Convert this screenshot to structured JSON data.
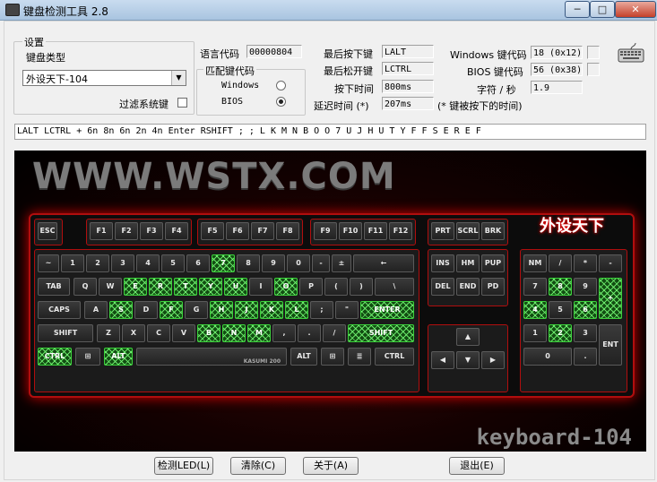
{
  "window": {
    "title": "键盘检测工具 2.8",
    "min_label": "─",
    "max_label": "□",
    "close_label": "✕"
  },
  "settings": {
    "group_label": "设置",
    "kbtype_label": "键盘类型",
    "kbtype_value": "外设天下-104",
    "filter_label": "过滤系统键",
    "lang_code_label": "语言代码",
    "lang_code_value": "00000804",
    "match_group_label": "匹配键代码",
    "windows_label": "Windows",
    "bios_label": "BIOS"
  },
  "status": {
    "last_press_label": "最后按下键",
    "last_press_value": "LALT",
    "last_release_label": "最后松开键",
    "last_release_value": "LCTRL",
    "press_time_label": "按下时间",
    "press_time_value": "800ms",
    "delay_label": "延迟时间 (*)",
    "delay_value": "207ms",
    "delay_note": "(* 键被按下的时间)",
    "win_code_label": "Windows 键代码",
    "win_code_value": "18 (0x12)",
    "bios_code_label": "BIOS 键代码",
    "bios_code_value": "56 (0x38)",
    "cps_label": "字符 / 秒",
    "cps_value": "1.9"
  },
  "log_text": "LALT LCTRL + 6n 8n 6n 2n 4n Enter RSHIFT ; ; L K M N B O O 7 U J H U T Y F F S E R E F",
  "keyboard": {
    "site_text": "WWW.WSTX.COM",
    "model_text": "keyboard-104",
    "brand_text": "外设天下",
    "spacebar_text": "KASUMI 200",
    "keys": [
      {
        "id": "esc",
        "label": "ESC",
        "on": false
      },
      {
        "id": "f1",
        "label": "F1",
        "on": false
      },
      {
        "id": "f2",
        "label": "F2",
        "on": false
      },
      {
        "id": "f3",
        "label": "F3",
        "on": false
      },
      {
        "id": "f4",
        "label": "F4",
        "on": false
      },
      {
        "id": "f5",
        "label": "F5",
        "on": false
      },
      {
        "id": "f6",
        "label": "F6",
        "on": false
      },
      {
        "id": "f7",
        "label": "F7",
        "on": false
      },
      {
        "id": "f8",
        "label": "F8",
        "on": false
      },
      {
        "id": "f9",
        "label": "F9",
        "on": false
      },
      {
        "id": "f10",
        "label": "F10",
        "on": false
      },
      {
        "id": "f11",
        "label": "F11",
        "on": false
      },
      {
        "id": "f12",
        "label": "F12",
        "on": false
      },
      {
        "id": "prt",
        "label": "PRT",
        "on": false
      },
      {
        "id": "scrl",
        "label": "SCRL",
        "on": false
      },
      {
        "id": "brk",
        "label": "BRK",
        "on": false
      },
      {
        "id": "tilde",
        "label": "~",
        "on": false
      },
      {
        "id": "k1",
        "label": "1",
        "on": false
      },
      {
        "id": "k2",
        "label": "2",
        "on": false
      },
      {
        "id": "k3",
        "label": "3",
        "on": false
      },
      {
        "id": "k4",
        "label": "4",
        "on": false
      },
      {
        "id": "k5",
        "label": "5",
        "on": false
      },
      {
        "id": "k6",
        "label": "6",
        "on": false
      },
      {
        "id": "k7",
        "label": "7",
        "on": true
      },
      {
        "id": "k8",
        "label": "8",
        "on": false
      },
      {
        "id": "k9",
        "label": "9",
        "on": false
      },
      {
        "id": "k0",
        "label": "0",
        "on": false
      },
      {
        "id": "minus",
        "label": "-",
        "on": false
      },
      {
        "id": "equal",
        "label": "±",
        "on": false
      },
      {
        "id": "bksp",
        "label": "←",
        "on": false
      },
      {
        "id": "ins",
        "label": "INS",
        "on": false
      },
      {
        "id": "home",
        "label": "HM",
        "on": false
      },
      {
        "id": "pgup",
        "label": "PUP",
        "on": false
      },
      {
        "id": "num",
        "label": "NM",
        "on": false
      },
      {
        "id": "ndiv",
        "label": "/",
        "on": false
      },
      {
        "id": "nmul",
        "label": "*",
        "on": false
      },
      {
        "id": "nsub",
        "label": "-",
        "on": false
      },
      {
        "id": "tab",
        "label": "TAB",
        "on": false
      },
      {
        "id": "q",
        "label": "Q",
        "on": false
      },
      {
        "id": "w",
        "label": "W",
        "on": false
      },
      {
        "id": "e",
        "label": "E",
        "on": true
      },
      {
        "id": "r",
        "label": "R",
        "on": true
      },
      {
        "id": "t",
        "label": "T",
        "on": true
      },
      {
        "id": "y",
        "label": "Y",
        "on": true
      },
      {
        "id": "u",
        "label": "U",
        "on": true
      },
      {
        "id": "i",
        "label": "I",
        "on": false
      },
      {
        "id": "o",
        "label": "O",
        "on": true
      },
      {
        "id": "p",
        "label": "P",
        "on": false
      },
      {
        "id": "lbr",
        "label": "(",
        "on": false
      },
      {
        "id": "rbr",
        "label": ")",
        "on": false
      },
      {
        "id": "bsl",
        "label": "\\",
        "on": false
      },
      {
        "id": "del",
        "label": "DEL",
        "on": false
      },
      {
        "id": "end",
        "label": "END",
        "on": false
      },
      {
        "id": "pgdn",
        "label": "PD",
        "on": false
      },
      {
        "id": "n7",
        "label": "7",
        "on": false
      },
      {
        "id": "n8",
        "label": "8",
        "on": true
      },
      {
        "id": "n9",
        "label": "9",
        "on": false
      },
      {
        "id": "nadd",
        "label": "+",
        "on": true
      },
      {
        "id": "caps",
        "label": "CAPS",
        "on": false
      },
      {
        "id": "a",
        "label": "A",
        "on": false
      },
      {
        "id": "s",
        "label": "S",
        "on": true
      },
      {
        "id": "d",
        "label": "D",
        "on": false
      },
      {
        "id": "f",
        "label": "F",
        "on": true
      },
      {
        "id": "g",
        "label": "G",
        "on": false
      },
      {
        "id": "h",
        "label": "H",
        "on": true
      },
      {
        "id": "j",
        "label": "J",
        "on": true
      },
      {
        "id": "k",
        "label": "K",
        "on": true
      },
      {
        "id": "l",
        "label": "L",
        "on": true
      },
      {
        "id": "semi",
        "label": ";",
        "on": false
      },
      {
        "id": "quote",
        "label": "\"",
        "on": false
      },
      {
        "id": "enter",
        "label": "ENTER",
        "on": true
      },
      {
        "id": "n4",
        "label": "4",
        "on": true
      },
      {
        "id": "n5",
        "label": "5",
        "on": false
      },
      {
        "id": "n6",
        "label": "6",
        "on": true
      },
      {
        "id": "lshift",
        "label": "SHIFT",
        "on": false
      },
      {
        "id": "z",
        "label": "Z",
        "on": false
      },
      {
        "id": "x",
        "label": "X",
        "on": false
      },
      {
        "id": "c",
        "label": "C",
        "on": false
      },
      {
        "id": "v",
        "label": "V",
        "on": false
      },
      {
        "id": "b",
        "label": "B",
        "on": true
      },
      {
        "id": "n",
        "label": "N",
        "on": true
      },
      {
        "id": "m",
        "label": "M",
        "on": true
      },
      {
        "id": "comma",
        "label": ",",
        "on": false
      },
      {
        "id": "period",
        "label": ".",
        "on": false
      },
      {
        "id": "slash",
        "label": "/",
        "on": false
      },
      {
        "id": "rshift",
        "label": "SHIFT",
        "on": true
      },
      {
        "id": "up",
        "label": "▲",
        "on": false
      },
      {
        "id": "n1",
        "label": "1",
        "on": false
      },
      {
        "id": "n2",
        "label": "2",
        "on": true
      },
      {
        "id": "n3",
        "label": "3",
        "on": false
      },
      {
        "id": "nent",
        "label": "ENT",
        "on": false
      },
      {
        "id": "lctrl",
        "label": "CTRL",
        "on": true
      },
      {
        "id": "lwin",
        "label": "⊞",
        "on": false
      },
      {
        "id": "lalt",
        "label": "ALT",
        "on": true
      },
      {
        "id": "space",
        "label": "",
        "on": false
      },
      {
        "id": "ralt",
        "label": "ALT",
        "on": false
      },
      {
        "id": "rwin",
        "label": "⊞",
        "on": false
      },
      {
        "id": "menu",
        "label": "≣",
        "on": false
      },
      {
        "id": "rctrl",
        "label": "CTRL",
        "on": false
      },
      {
        "id": "left",
        "label": "◀",
        "on": false
      },
      {
        "id": "down",
        "label": "▼",
        "on": false
      },
      {
        "id": "right",
        "label": "▶",
        "on": false
      },
      {
        "id": "n0",
        "label": "0",
        "on": false
      },
      {
        "id": "ndot",
        "label": ".",
        "on": false
      }
    ]
  },
  "buttons": {
    "led_label": "检测LED(L)",
    "clear_label": "清除(C)",
    "about_label": "关于(A)",
    "exit_label": "退出(E)"
  }
}
